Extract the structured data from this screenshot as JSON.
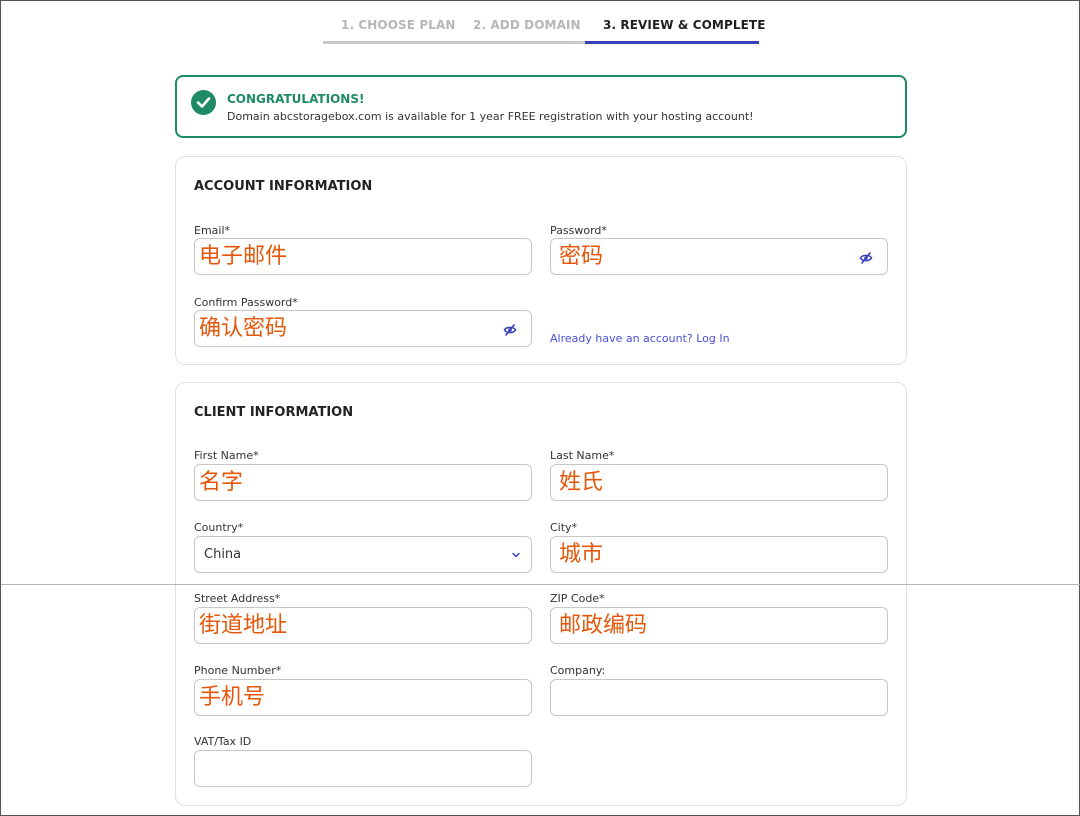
{
  "steps": [
    {
      "label": "1. CHOOSE PLAN"
    },
    {
      "label": "2. ADD DOMAIN"
    },
    {
      "label": "3. REVIEW & COMPLETE"
    }
  ],
  "banner": {
    "title": "CONGRATULATIONS!",
    "message": "Domain abcstoragebox.com is available for 1 year FREE registration with your hosting account!"
  },
  "account": {
    "title": "ACCOUNT INFORMATION",
    "email_label": "Email*",
    "email_value": "电子邮件",
    "password_label": "Password*",
    "password_value": "密码",
    "confirm_label": "Confirm Password*",
    "confirm_value": "确认密码",
    "login_link": "Already have an account? Log In"
  },
  "client": {
    "title": "CLIENT INFORMATION",
    "first_name_label": "First Name*",
    "first_name_value": "名字",
    "last_name_label": "Last Name*",
    "last_name_value": "姓氏",
    "country_label": "Country*",
    "country_value": "China",
    "city_label": "City*",
    "city_value": "城市",
    "street_label": "Street Address*",
    "street_value": "街道地址",
    "zip_label": "ZIP Code*",
    "zip_value": "邮政编码",
    "phone_label": "Phone Number*",
    "phone_value": "手机号",
    "company_label": "Company:",
    "company_value": "",
    "vat_label": "VAT/Tax ID",
    "vat_value": ""
  },
  "colors": {
    "success": "#1e8a66",
    "accent": "#3b3fb5",
    "link": "#4a4fd6",
    "annotation": "#e5570a",
    "inactive_step": "#b6b6b6"
  },
  "icons": {
    "banner": "check-circle-icon",
    "password_toggle": "eye-slash-icon",
    "country_select": "chevron-down-icon"
  }
}
